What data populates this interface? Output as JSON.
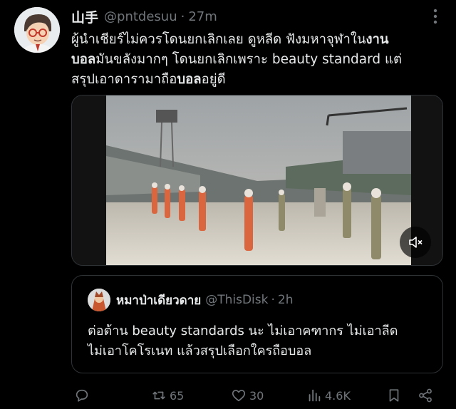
{
  "tweet": {
    "display_name": "山手",
    "handle": "@pntdesuu",
    "separator": "·",
    "time": "27m",
    "text_lines": [
      [
        {
          "t": "ผู้นำเชียร์ไม่ควรโดนยกเลิกเลย ดูหลีด ฟังมหาจุฬาใน"
        },
        {
          "t": "งาน",
          "b": true
        }
      ],
      [
        {
          "t": "บอล",
          "b": true
        },
        {
          "t": "มันขลังมากๆ โดนยกเลิกเพราะ beauty standard แต่"
        }
      ],
      [
        {
          "t": "สรุปเอาดารามาถือ"
        },
        {
          "t": "บอล",
          "b": true
        },
        {
          "t": "อยู่ดี"
        }
      ]
    ]
  },
  "quote": {
    "display_name": "หมาป่าเดียวดาย",
    "handle": "@ThisDisk",
    "separator": "·",
    "time": "2h",
    "text_lines": [
      "ต่อต้าน beauty standards นะ ไม่เอาคฑากร ไม่เอาลีด",
      "ไม่เอาโคโรเนท แล้วสรุปเลือกใครถือบอล"
    ]
  },
  "actions": {
    "reply_count": "",
    "retweet_count": "65",
    "like_count": "30",
    "views_count": "4.6K"
  },
  "icons": {
    "reply": "reply-icon",
    "retweet": "retweet-icon",
    "like": "heart-icon",
    "views": "views-icon",
    "bookmark": "bookmark-icon",
    "share": "share-icon",
    "mute": "mute-icon",
    "more": "more-icon"
  },
  "colors": {
    "background": "#000000",
    "text": "#e7e9ea",
    "muted": "#71767b",
    "border": "#2f3336"
  }
}
